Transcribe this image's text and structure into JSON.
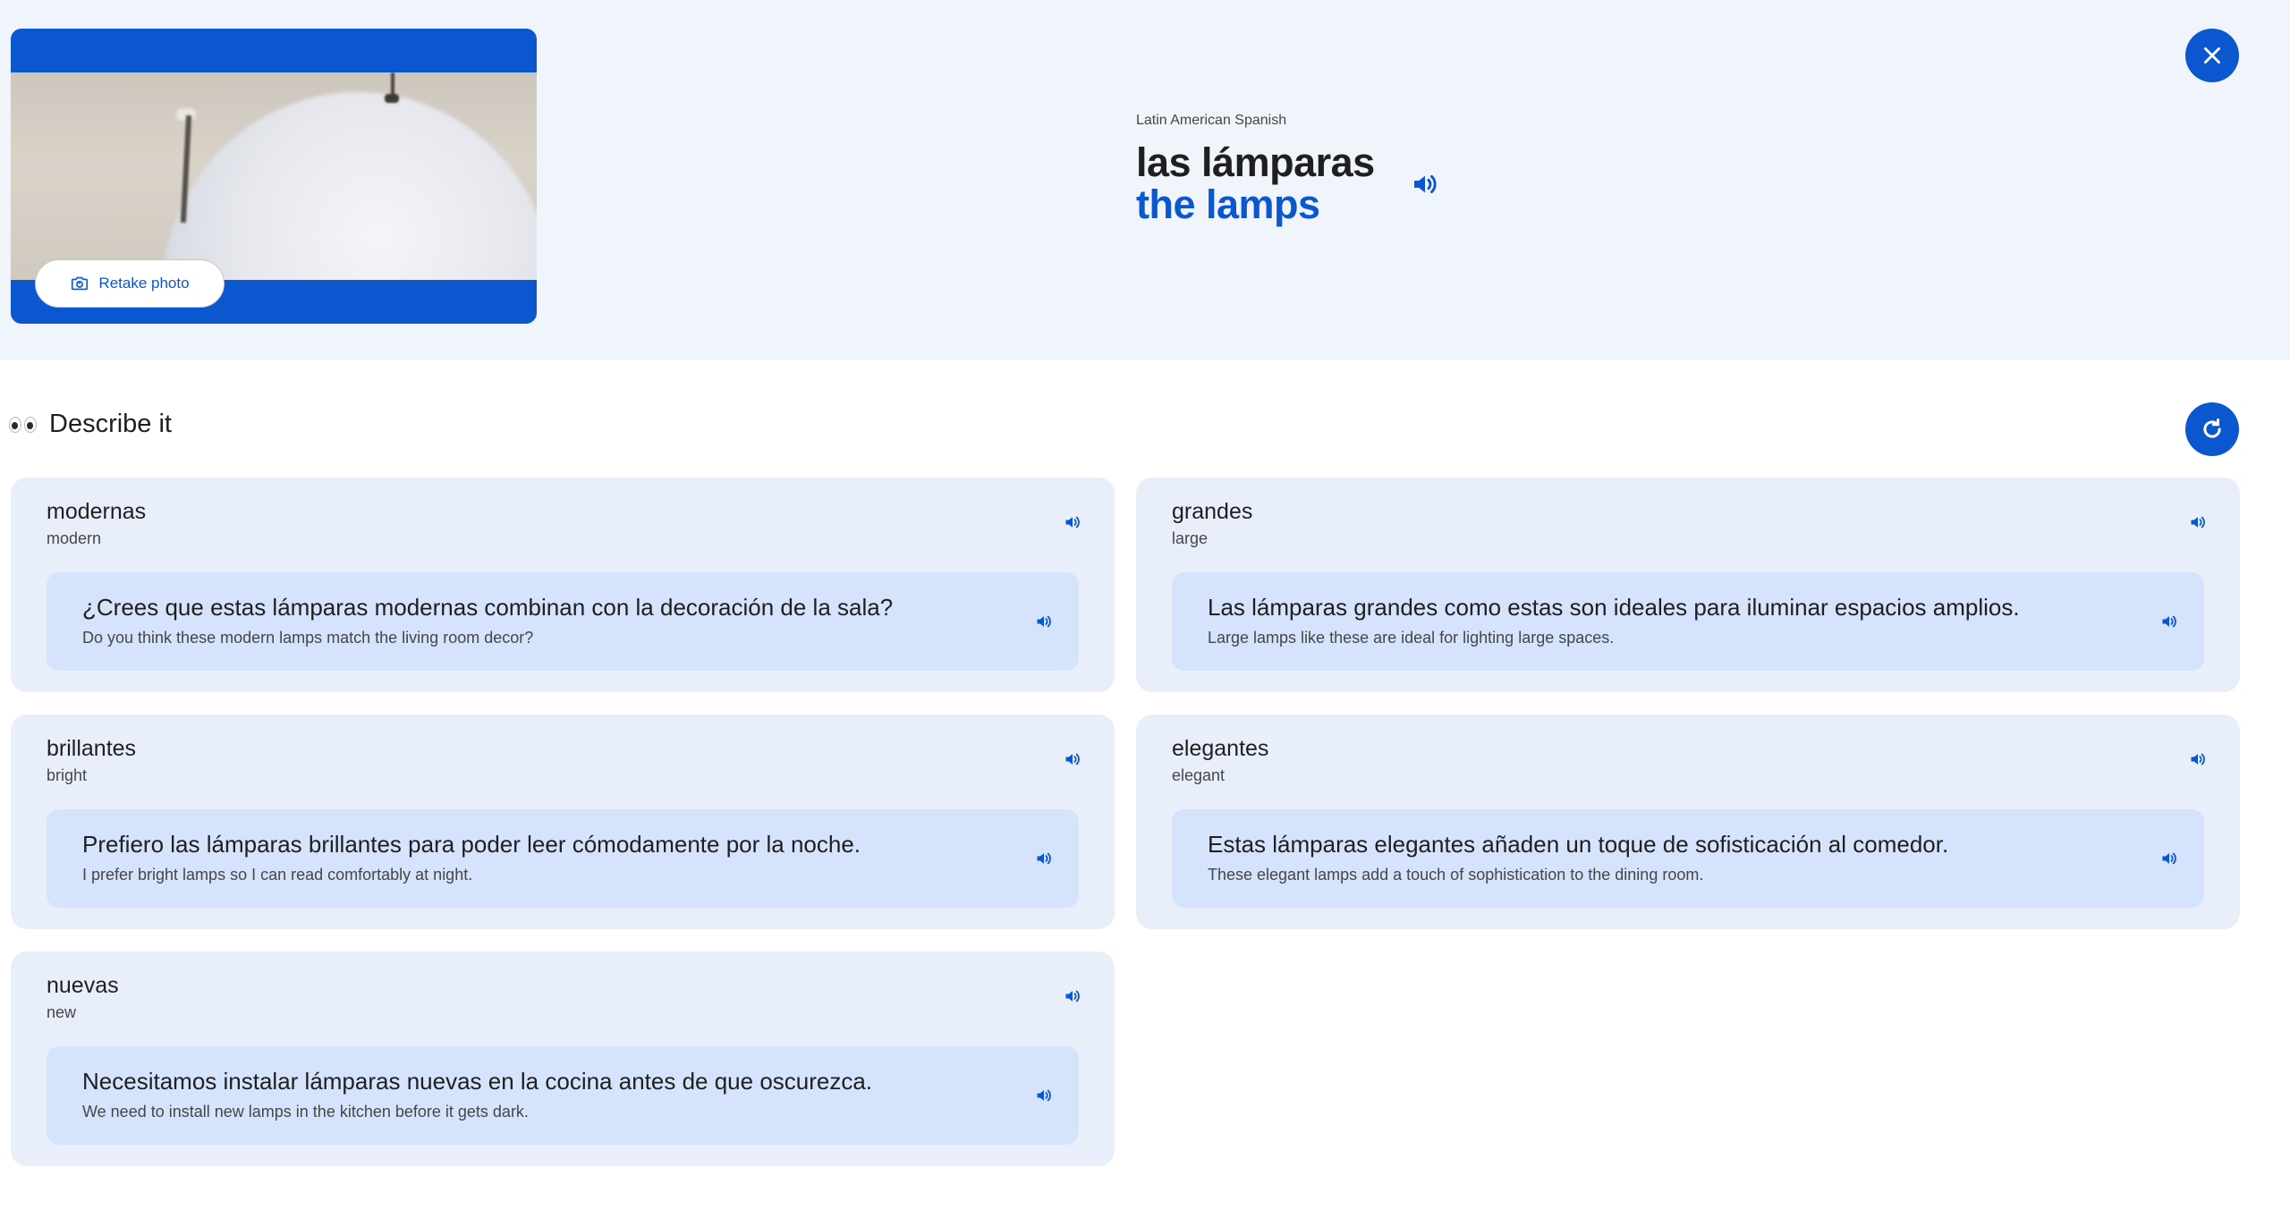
{
  "header": {
    "retake_label": "Retake photo",
    "language": "Latin American Spanish",
    "term": "las lámparas",
    "translation": "the lamps"
  },
  "describe": {
    "title": "Describe it",
    "cards": [
      {
        "word": "modernas",
        "meaning": "modern",
        "sentence_es": "¿Crees que estas lámparas modernas combinan con la decoración de la sala?",
        "sentence_en": "Do you think these modern lamps match the living room decor?"
      },
      {
        "word": "grandes",
        "meaning": "large",
        "sentence_es": "Las lámparas grandes como estas son ideales para iluminar espacios amplios.",
        "sentence_en": "Large lamps like these are ideal for lighting large spaces."
      },
      {
        "word": "brillantes",
        "meaning": "bright",
        "sentence_es": "Prefiero las lámparas brillantes para poder leer cómodamente por la noche.",
        "sentence_en": "I prefer bright lamps so I can read comfortably at night."
      },
      {
        "word": "elegantes",
        "meaning": "elegant",
        "sentence_es": "Estas lámparas elegantes añaden un toque de sofisticación al comedor.",
        "sentence_en": "These elegant lamps add a touch of sophistication to the dining room."
      },
      {
        "word": "nuevas",
        "meaning": "new",
        "sentence_es": "Necesitamos instalar lámparas nuevas en la cocina antes de que oscurezca.",
        "sentence_en": "We need to install new lamps in the kitchen before it gets dark."
      }
    ]
  },
  "icons": {
    "close": "close-icon",
    "refresh": "refresh-icon",
    "speaker": "speaker-icon",
    "camera": "camera-icon",
    "eyes": "eyes-emoji-icon"
  },
  "colors": {
    "accent": "#0b57d0",
    "header_bg": "#f0f4fb",
    "card_bg": "#e8effb",
    "sentence_bg": "#d6e3fc"
  }
}
